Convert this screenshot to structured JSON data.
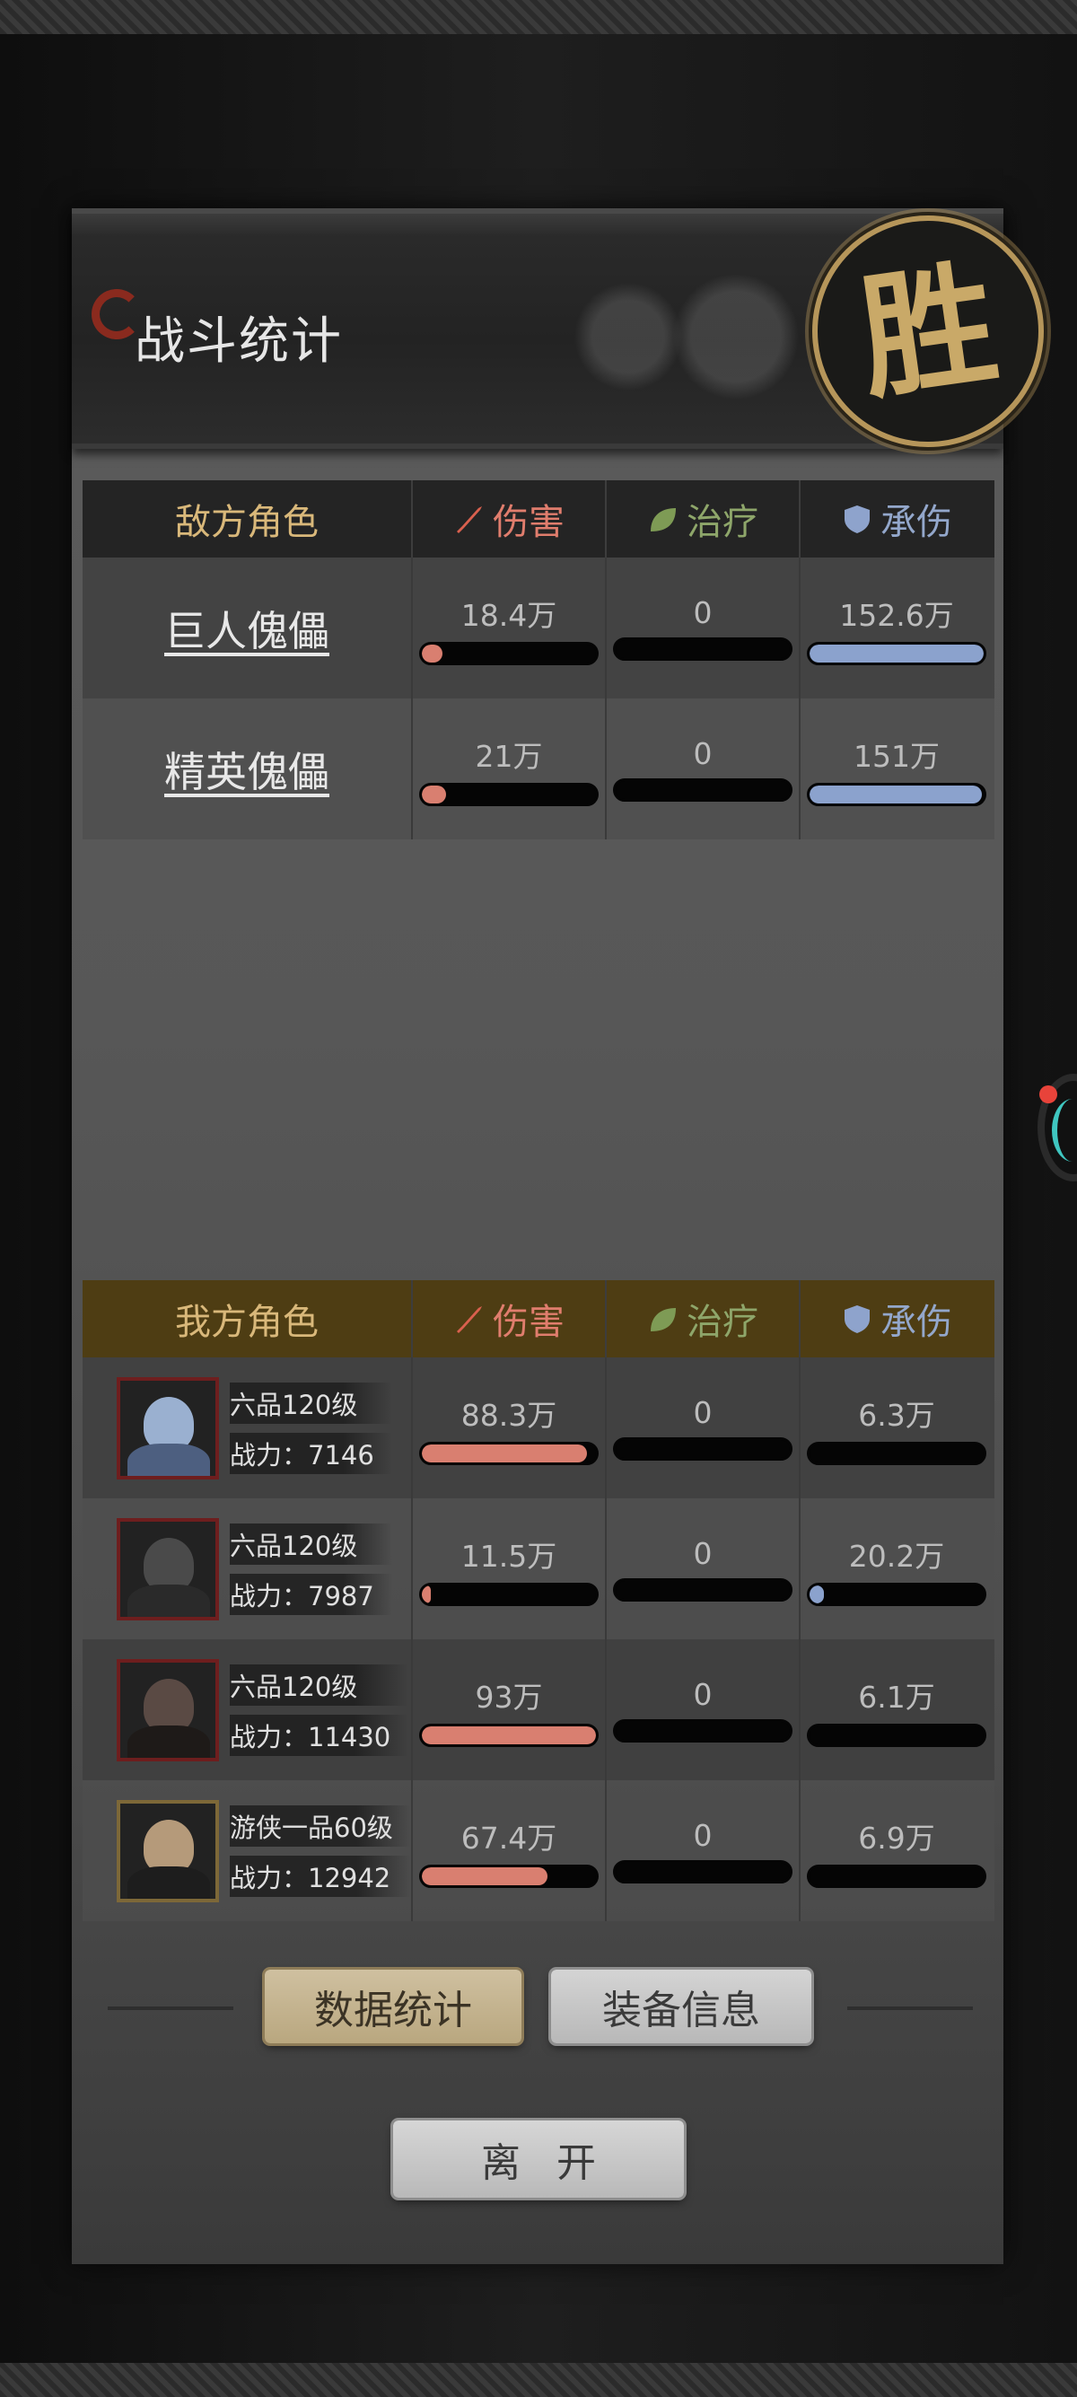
{
  "header": {
    "title": "战斗统计",
    "result_badge": "胜"
  },
  "enemy": {
    "columns": {
      "name": "敌方角色",
      "damage": "伤害",
      "heal": "治疗",
      "tank": "承伤"
    },
    "rows": [
      {
        "name": "巨人傀儡",
        "damage": "18.4万",
        "heal": "0",
        "tank": "152.6万",
        "damage_pct": 12,
        "heal_pct": 0,
        "tank_pct": 100
      },
      {
        "name": "精英傀儡",
        "damage": "21万",
        "heal": "0",
        "tank": "151万",
        "damage_pct": 14,
        "heal_pct": 0,
        "tank_pct": 99
      }
    ]
  },
  "ally": {
    "columns": {
      "name": "我方角色",
      "damage": "伤害",
      "heal": "治疗",
      "tank": "承伤"
    },
    "rows": [
      {
        "rank": "六品120级",
        "power": "战力：7146",
        "damage": "88.3万",
        "heal": "0",
        "tank": "6.3万",
        "damage_pct": 95,
        "heal_pct": 0,
        "tank_pct": 0
      },
      {
        "rank": "六品120级",
        "power": "战力：7987",
        "damage": "11.5万",
        "heal": "0",
        "tank": "20.2万",
        "damage_pct": 5,
        "heal_pct": 0,
        "tank_pct": 8
      },
      {
        "rank": "六品120级",
        "power": "战力：11430",
        "damage": "93万",
        "heal": "0",
        "tank": "6.1万",
        "damage_pct": 100,
        "heal_pct": 0,
        "tank_pct": 0
      },
      {
        "rank": "游侠一品60级",
        "power": "战力：12942",
        "damage": "67.4万",
        "heal": "0",
        "tank": "6.9万",
        "damage_pct": 72,
        "heal_pct": 0,
        "tank_pct": 0
      }
    ]
  },
  "buttons": {
    "stats": "数据统计",
    "equip": "装备信息",
    "leave": "离开"
  },
  "icons": {
    "damage": "sword-icon",
    "heal": "leaf-icon",
    "tank": "shield-icon"
  },
  "colors": {
    "damage": "#d97f70",
    "heal": "#8ea66a",
    "tank": "#8ba2cd",
    "accent_gold": "#d9b87a"
  }
}
